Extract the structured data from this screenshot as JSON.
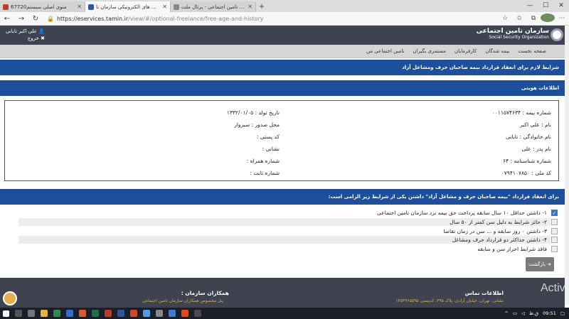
{
  "browser": {
    "tabs": [
      {
        "title": "منوی اصلی سیستم67720"
      },
      {
        "title": "سرویس های الکترونیکی سازمان تا"
      },
      {
        "title": "سازمان تامین اجتماعی - پرتال ملت"
      }
    ],
    "url_host": "https://eservices.tamin.ir",
    "url_path": "/view/#/optional-freelance/free-age-and-history"
  },
  "header": {
    "user_name": "علی اکبر تابانی",
    "logout_label": "خروج",
    "org_name_fa": "سازمان تامین اجتماعی",
    "org_name_en": "Social Security Organization"
  },
  "menu": [
    "صفحه نخست",
    "بیمه شدگان",
    "کارفرمایان",
    "مستمری بگیران",
    "تامین اجتماعی من"
  ],
  "page_title": "شرایط لازم برای انعقاد قرارداد بیمه صاحبان حرف ومشاغل آزاد",
  "identity": {
    "section_title": "اطلاعات هویتی",
    "right_fields": [
      "شماره بیمه : ۰۰۱۱۵۷۴۶۳۴",
      "نام : علی اکبر",
      "نام خانوادگی : تابانی",
      "نام پدر : علی",
      "شماره شناسنامه : ۶۴",
      "کد ملی : ۰۷۹۴۱۰۷۸۵۰"
    ],
    "left_fields": [
      "تاریخ تولد : ۱۳۳۲/۰۱/۰۵",
      "محل صدور : سبزوار",
      "کد پستی :",
      "نشانی :",
      "شماره همراه :",
      "شماره ثابت :"
    ]
  },
  "conditions": {
    "section_title": "برای انعقاد قرارداد \"بیمه صاحبان حرف و مشاغل آزاد\" داشتن یکی از شرایط زیر الزامی است:",
    "items": [
      {
        "label": "۱- داشتن حداقل ۱۰ سال سابقه پرداخت حق بیمه نزد سازمان تامین اجتماعی",
        "checked": true
      },
      {
        "label": "۲- حائز شرایط به دلیل سن کمتر از ۵۰ سال",
        "checked": false
      },
      {
        "label": "۳- داشتن ۰ روز سابقه و ... سن در زمان تقاضا",
        "checked": false
      },
      {
        "label": "۴- داشتن حداکثر دو قرارداد حرف ومشاغل",
        "checked": false
      },
      {
        "label": "فاقد شرایط احراز سن و سابقه",
        "checked": false
      }
    ],
    "back_label": "بازگشت"
  },
  "footer": {
    "contact_title": "اطلاعات تماس",
    "contact_text": "نشانی: تهران، خیابان آزادی، پلاک ۳۹۵، کدپستی ۱۴۵۳۹۶۵۵۹۵",
    "partners_title": "همکاران سازمان :",
    "partners_text": "پنل مخصوص همکاران سازمان تامین اجتماعی"
  },
  "taskbar": {
    "time": "09:51",
    "lang": "ق.ظ"
  },
  "watermark": "Activ"
}
